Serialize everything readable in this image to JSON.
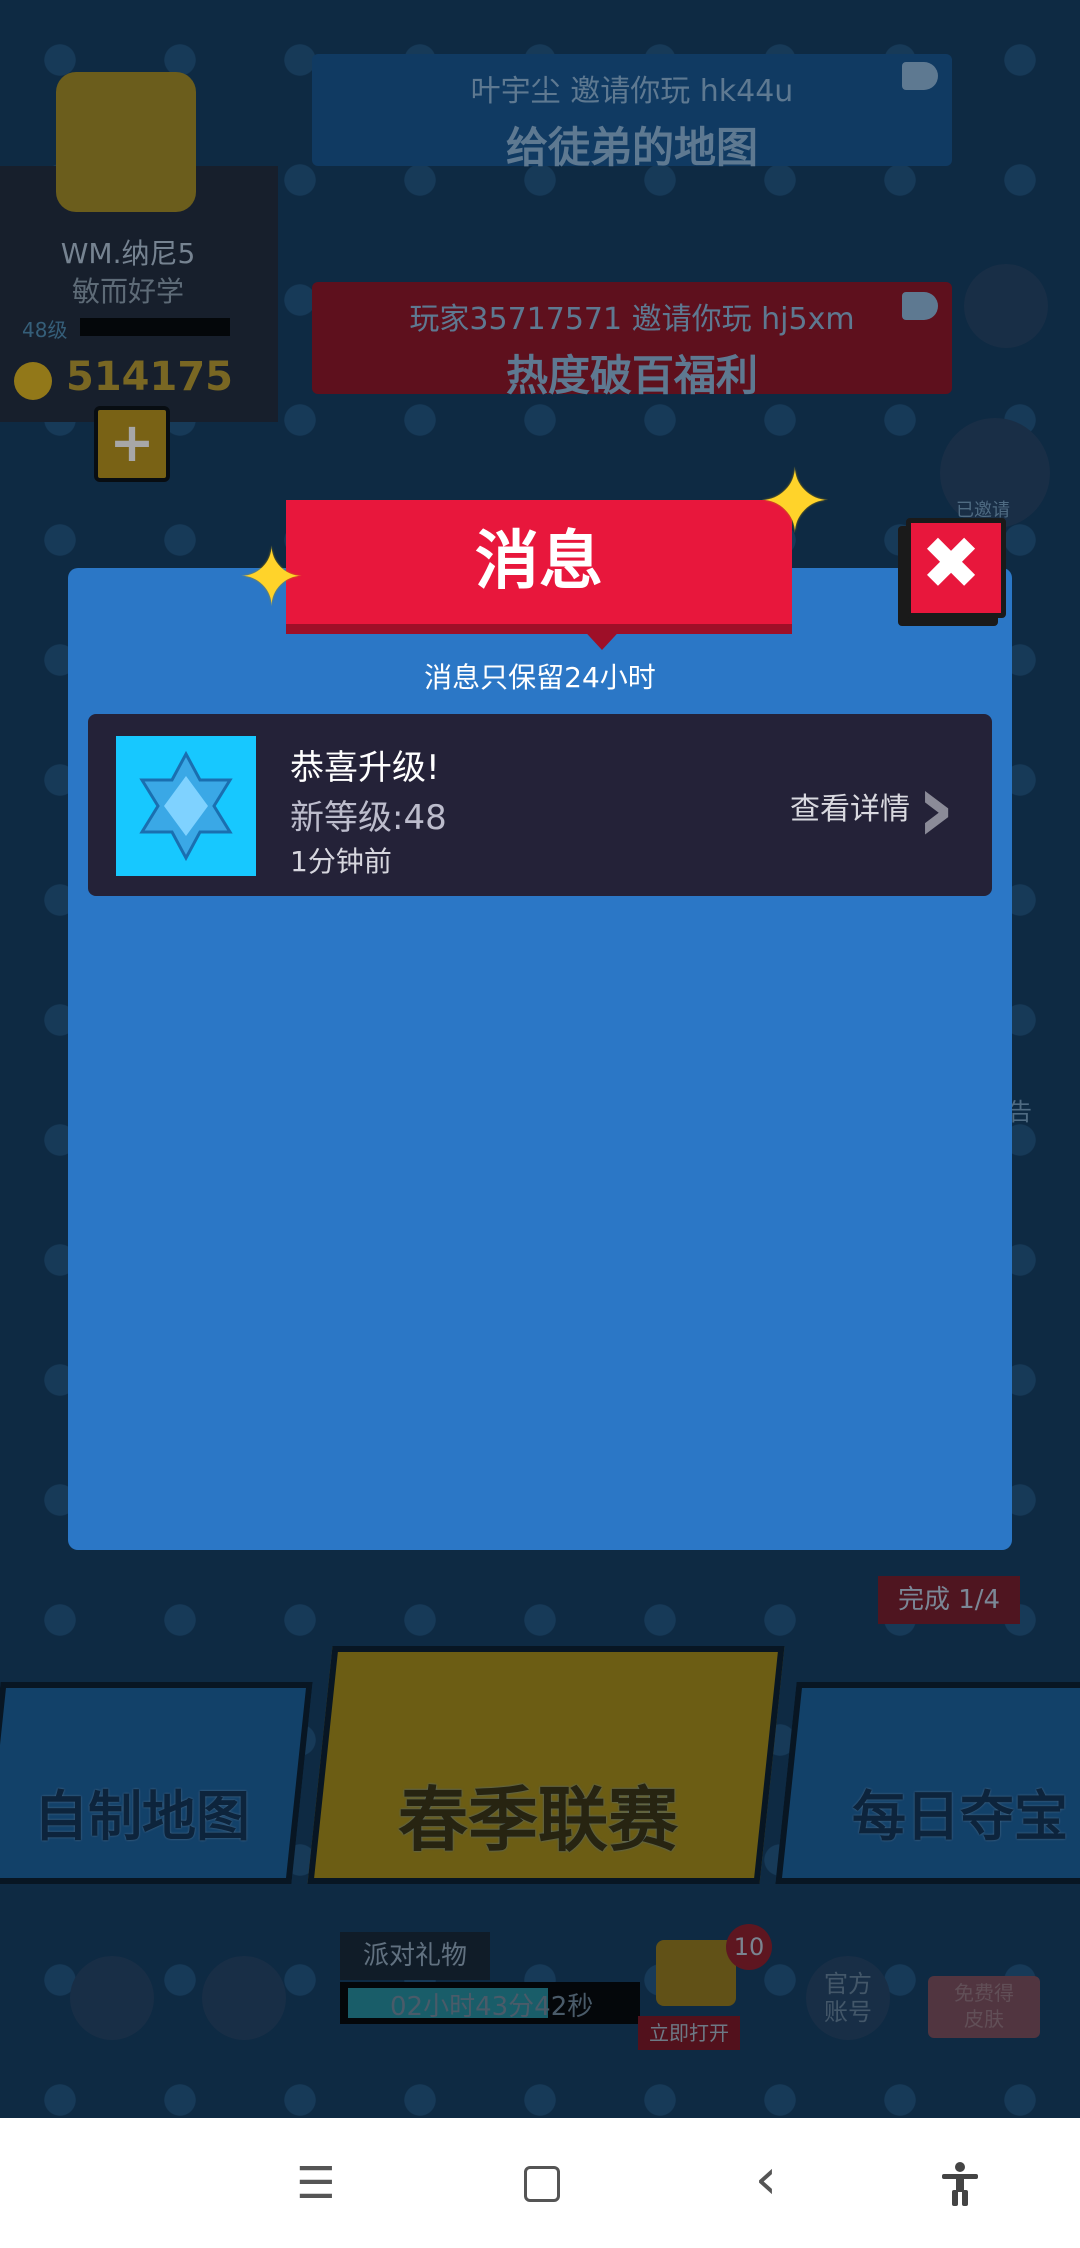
{
  "player": {
    "name": "WM.纳尼5",
    "title": "敏而好学",
    "level": "48级",
    "coins": "514175"
  },
  "invites": [
    {
      "line1": "叶宇尘 邀请你玩 hk44u",
      "line2": "给徒弟的地图"
    },
    {
      "line1": "玩家35717571 邀请你玩 hj5xm",
      "line2": "热度破百福利"
    }
  ],
  "side": {
    "invited_label": "已邀请",
    "notice_label": "告"
  },
  "modes": {
    "custom_map": "自制地图",
    "spring_league": "春季联赛",
    "daily_treasure": "每日夺宝",
    "treasure_progress": "完成 1/4"
  },
  "party_gift": {
    "title": "派对礼物",
    "timer": "02小时43分42秒",
    "badge": "10",
    "open_label": "立即打开"
  },
  "bottom": {
    "official_account": "官方\n账号",
    "free_skin": "免费得\n皮肤"
  },
  "dialog": {
    "title": "消息",
    "subtitle": "消息只保留24小时",
    "close_icon": "close-icon",
    "messages": [
      {
        "title": "恭喜升级!",
        "detail": "新等级:48",
        "time": "1分钟前",
        "action": "查看详情",
        "icon": "blue-gem-icon"
      }
    ]
  },
  "navbar": {
    "menu_icon": "☰",
    "home_icon": "▢",
    "back_icon": "‹",
    "accessibility_icon": "accessibility-icon"
  }
}
